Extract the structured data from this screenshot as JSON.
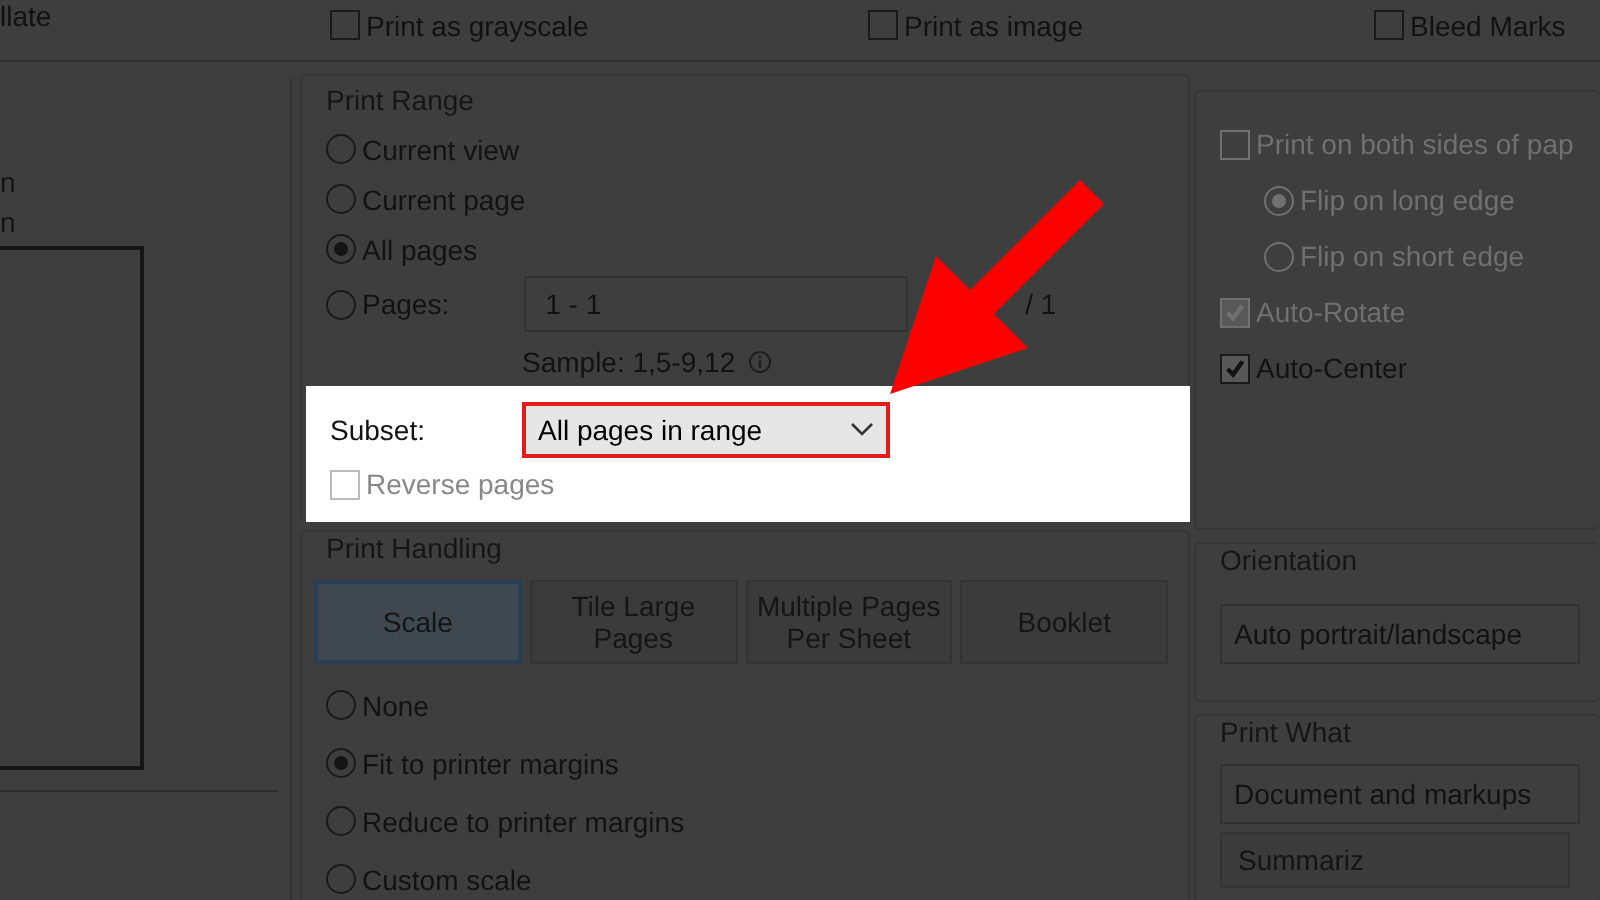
{
  "top_options": [
    {
      "kind": "text",
      "label": "llate"
    },
    {
      "kind": "checkbox",
      "label": "Print as grayscale",
      "checked": false
    },
    {
      "kind": "checkbox",
      "label": "Print as image",
      "checked": false
    },
    {
      "kind": "checkbox",
      "label": "Bleed Marks",
      "checked": false
    }
  ],
  "preview": {
    "labels": [
      "n",
      "n"
    ]
  },
  "print_range": {
    "title": "Print Range",
    "options": [
      {
        "label": "Current view",
        "selected": false
      },
      {
        "label": "Current page",
        "selected": false
      },
      {
        "label": "All pages",
        "selected": true
      },
      {
        "label": "Pages:",
        "selected": false
      }
    ],
    "pages_field": {
      "value": "1 - 1",
      "total": "/ 1"
    },
    "sample": "Sample: 1,5-9,12",
    "subset": {
      "label": "Subset:",
      "value": "All pages in range",
      "highlighted": true
    },
    "reverse_pages": {
      "label": "Reverse pages",
      "checked": false,
      "disabled": true
    }
  },
  "print_handling": {
    "title": "Print Handling",
    "tabs": [
      {
        "label": "Scale",
        "selected": true
      },
      {
        "label": "Tile Large Pages",
        "selected": false
      },
      {
        "label": "Multiple Pages Per Sheet",
        "selected": false
      },
      {
        "label": "Booklet",
        "selected": false
      }
    ],
    "options": [
      {
        "label": "None",
        "selected": false
      },
      {
        "label": "Fit to printer margins",
        "selected": true
      },
      {
        "label": "Reduce to printer margins",
        "selected": false
      },
      {
        "label": "Custom scale",
        "selected": false
      }
    ]
  },
  "duplex": {
    "items": [
      {
        "kind": "checkbox",
        "label": "Print on both sides of pap",
        "checked": false,
        "disabled": true
      },
      {
        "kind": "radio",
        "label": "Flip on long edge",
        "checked": true,
        "disabled": true
      },
      {
        "kind": "radio",
        "label": "Flip on short edge",
        "checked": false,
        "disabled": true
      },
      {
        "kind": "checkbox",
        "label": "Auto-Rotate",
        "checked": true,
        "disabled": true
      },
      {
        "kind": "checkbox",
        "label": "Auto-Center",
        "checked": true,
        "disabled": false
      }
    ]
  },
  "orientation": {
    "title": "Orientation",
    "value": "Auto portrait/landscape"
  },
  "print_what": {
    "title": "Print What",
    "value": "Document and markups",
    "button": "Summariz"
  },
  "annotation": {
    "kind": "arrow"
  }
}
